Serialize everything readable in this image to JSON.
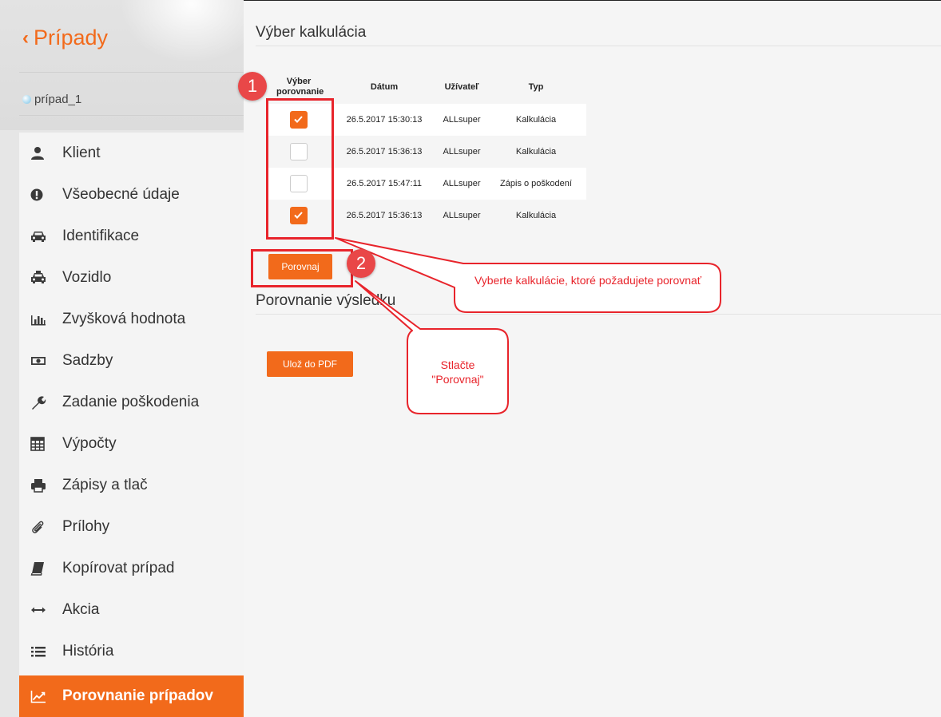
{
  "sidebar": {
    "back_label": "Prípady",
    "case_name": "prípad_1",
    "items": [
      {
        "label": "Klient",
        "icon": "user-icon"
      },
      {
        "label": "Všeobecné údaje",
        "icon": "exclamation-circle-icon"
      },
      {
        "label": "Identifikace",
        "icon": "car-icon"
      },
      {
        "label": "Vozidlo",
        "icon": "taxi-icon"
      },
      {
        "label": "Zvyšková hodnota",
        "icon": "bar-chart-icon"
      },
      {
        "label": "Sadzby",
        "icon": "money-icon"
      },
      {
        "label": "Zadanie poškodenia",
        "icon": "wrench-icon"
      },
      {
        "label": "Výpočty",
        "icon": "calculator-icon"
      },
      {
        "label": "Zápisy a tlač",
        "icon": "print-icon"
      },
      {
        "label": "Prílohy",
        "icon": "paperclip-icon"
      },
      {
        "label": "Kopírovat prípad",
        "icon": "book-icon"
      },
      {
        "label": "Akcia",
        "icon": "arrows-horizontal-icon"
      },
      {
        "label": "História",
        "icon": "list-icon"
      },
      {
        "label": "Porovnanie prípadov",
        "icon": "line-chart-icon",
        "active": true
      }
    ]
  },
  "main": {
    "title": "Výber kalkulácia",
    "table": {
      "headers": {
        "select": "Výber porovnanie",
        "date": "Dátum",
        "user": "Užívateľ",
        "type": "Typ"
      },
      "rows": [
        {
          "checked": true,
          "date": "26.5.2017 15:30:13",
          "user": "ALLsuper",
          "type": "Kalkulácia"
        },
        {
          "checked": false,
          "date": "26.5.2017 15:36:13",
          "user": "ALLsuper",
          "type": "Kalkulácia"
        },
        {
          "checked": false,
          "date": "26.5.2017 15:47:11",
          "user": "ALLsuper",
          "type": "Zápis o poškodení"
        },
        {
          "checked": true,
          "date": "26.5.2017 15:36:13",
          "user": "ALLsuper",
          "type": "Kalkulácia"
        }
      ]
    },
    "compare_button": "Porovnaj",
    "results_title": "Porovnanie výsledku",
    "pdf_button": "Ulož do PDF"
  },
  "annotations": {
    "badge1": "1",
    "badge2": "2",
    "callout1": "Vyberte kalkulácie, ktoré požadujete porovnať",
    "callout2": "Stlačte \"Porovnaj\""
  },
  "colors": {
    "accent": "#f26a1b",
    "annotation_red": "#e8242b"
  }
}
